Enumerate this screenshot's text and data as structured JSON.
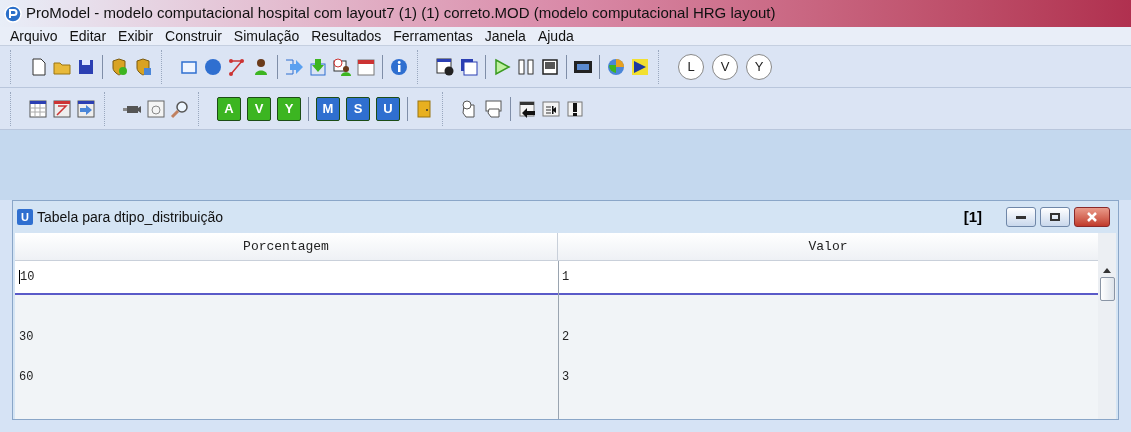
{
  "window": {
    "title": "ProModel - modelo computacional hospital com layout7 (1) (1) correto.MOD (modelo computacional HRG layout)"
  },
  "menu": [
    "Arquivo",
    "Editar",
    "Exibir",
    "Construir",
    "Simulação",
    "Resultados",
    "Ferramentas",
    "Janela",
    "Ajuda"
  ],
  "toolbars": [
    {
      "letter_buttons": [
        {
          "text": "L",
          "color": "#ffffff"
        },
        {
          "text": "V",
          "color": "#ffffff"
        },
        {
          "text": "Y",
          "color": "#ffffff"
        }
      ]
    },
    {
      "letter_buttons": [
        {
          "text": "A",
          "color": "#3cb521"
        },
        {
          "text": "V",
          "color": "#3cb521"
        },
        {
          "text": "Y",
          "color": "#3cb521"
        },
        {
          "text": "M",
          "color": "#2f6fd0"
        },
        {
          "text": "S",
          "color": "#2f6fd0"
        },
        {
          "text": "U",
          "color": "#2f6fd0"
        }
      ]
    }
  ],
  "child_window": {
    "icon_letter": "U",
    "title": "Tabela para dtipo_distribuição",
    "index": "[1]",
    "table": {
      "columns": [
        "Porcentagem",
        "Valor"
      ],
      "rows": [
        {
          "cells": [
            "10",
            "1"
          ],
          "selected": true
        },
        {
          "cells": [
            "30",
            "2"
          ],
          "selected": false
        },
        {
          "cells": [
            "60",
            "3"
          ],
          "selected": false
        }
      ]
    }
  }
}
